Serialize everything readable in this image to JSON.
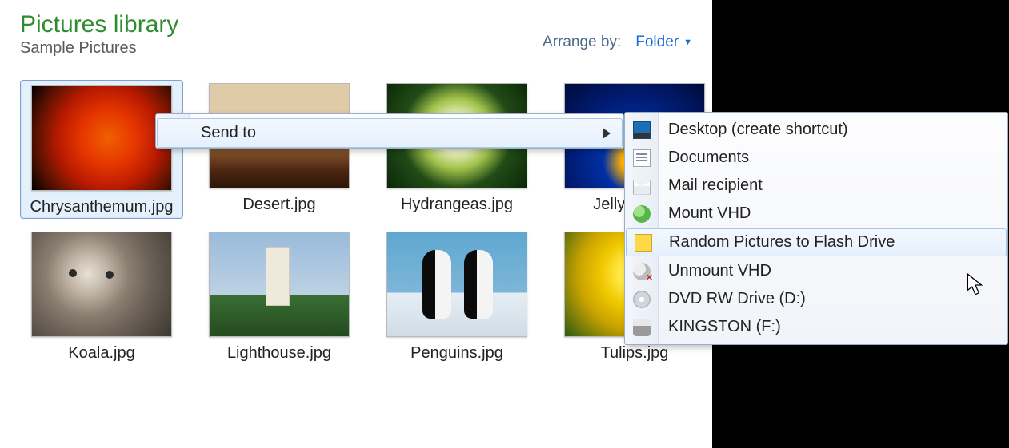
{
  "header": {
    "title": "Pictures library",
    "subtitle": "Sample Pictures",
    "arrange_label": "Arrange by:",
    "arrange_value": "Folder"
  },
  "items": [
    {
      "label": "Chrysanthemum.jpg",
      "selected": true,
      "art": "chrys"
    },
    {
      "label": "Desert.jpg",
      "selected": false,
      "art": "desert"
    },
    {
      "label": "Hydrangeas.jpg",
      "selected": false,
      "art": "hydra"
    },
    {
      "label": "Jellyfish.jpg",
      "selected": false,
      "art": "jelly"
    },
    {
      "label": "Koala.jpg",
      "selected": false,
      "art": "koala"
    },
    {
      "label": "Lighthouse.jpg",
      "selected": false,
      "art": "light"
    },
    {
      "label": "Penguins.jpg",
      "selected": false,
      "art": "peng"
    },
    {
      "label": "Tulips.jpg",
      "selected": false,
      "art": "tulip"
    }
  ],
  "context_menu": {
    "sendto_label": "Send to",
    "targets": [
      {
        "label": "Desktop (create shortcut)",
        "icon": "ic-desktop",
        "name": "sendto-desktop"
      },
      {
        "label": "Documents",
        "icon": "ic-doc",
        "name": "sendto-documents"
      },
      {
        "label": "Mail recipient",
        "icon": "ic-mail",
        "name": "sendto-mail"
      },
      {
        "label": "Mount VHD",
        "icon": "ic-vhd",
        "name": "sendto-mount-vhd"
      },
      {
        "label": "Random Pictures to Flash Drive",
        "icon": "ic-kbd",
        "name": "sendto-random-pictures",
        "highlight": true
      },
      {
        "label": "Unmount VHD",
        "icon": "ic-vhdx",
        "name": "sendto-unmount-vhd"
      },
      {
        "label": "DVD RW Drive (D:)",
        "icon": "ic-dvd",
        "name": "sendto-dvd-d"
      },
      {
        "label": "KINGSTON (F:)",
        "icon": "ic-usb",
        "name": "sendto-kingston-f"
      }
    ]
  }
}
